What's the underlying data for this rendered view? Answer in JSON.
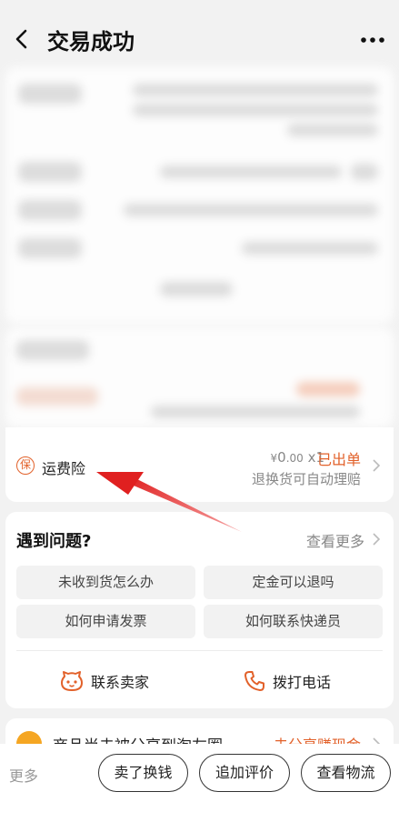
{
  "header": {
    "title": "交易成功"
  },
  "insurance": {
    "icon_char": "保",
    "label": "运费险",
    "currency": "¥",
    "price_int": "0",
    "price_dec": ".00",
    "qty": "x1",
    "status": "已出单",
    "sub": "退换货可自动理赔"
  },
  "faq": {
    "title": "遇到问题?",
    "more": "查看更多",
    "questions": [
      "未收到货怎么办",
      "定金可以退吗",
      "如何申请发票",
      "如何联系快递员"
    ],
    "contact_seller": "联系卖家",
    "call": "拨打电话"
  },
  "share": {
    "text": "商品尚未被分享到淘友圈",
    "action": "去分享赚现金"
  },
  "bottom": {
    "more": "更多",
    "buttons": [
      "卖了换钱",
      "追加评价",
      "查看物流"
    ]
  },
  "colors": {
    "accent": "#e2612a",
    "arrow": "#e02020"
  },
  "icons": [
    "back-arrow-icon",
    "more-dots-icon",
    "insurance-icon",
    "chevron-right-icon",
    "seller-face-icon",
    "phone-icon"
  ]
}
